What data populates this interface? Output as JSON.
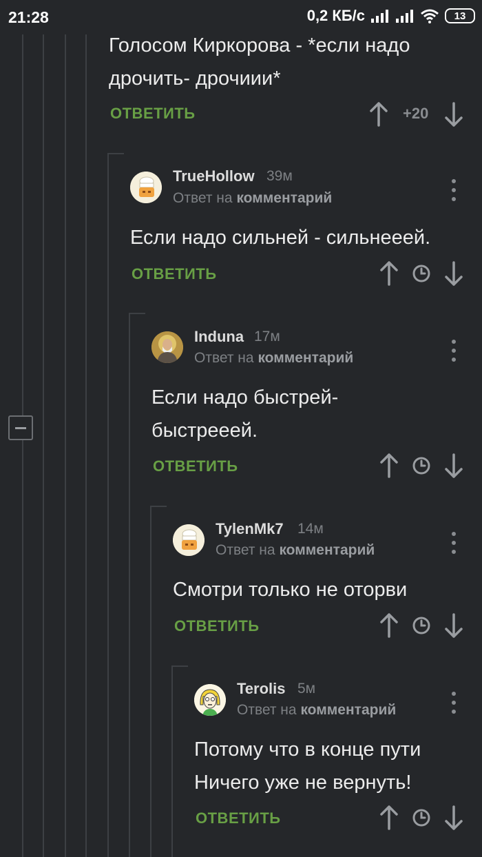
{
  "status_bar": {
    "time": "21:28",
    "net_speed": "0,2 КБ/с",
    "battery": "13",
    "icons": [
      "signal-icon",
      "signal-icon",
      "wifi-icon",
      "battery-icon"
    ]
  },
  "colors": {
    "background": "#25272a",
    "reply_green": "#689f45",
    "muted": "#7d8084"
  },
  "top_comment": {
    "text_line1": "Голосом Киркорова - *если надо",
    "text_line2": "дрочить- дрочиии*",
    "reply_label": "ОТВЕТИТЬ",
    "rating": "+20"
  },
  "comments": [
    {
      "author": "TrueHollow",
      "time": "39м",
      "reply_prefix": "Ответ на",
      "reply_target": "комментарий",
      "text_line1": "Если надо сильней - сильнееей.",
      "text_line2": "",
      "reply_label": "ОТВЕТИТЬ",
      "avatar": "chef-avatar"
    },
    {
      "author": "Induna",
      "time": "17м",
      "reply_prefix": "Ответ на",
      "reply_target": "комментарий",
      "text_line1": "Если надо быстрей-",
      "text_line2": "быстрееей.",
      "reply_label": "ОТВЕТИТЬ",
      "avatar": "icon-saint-avatar"
    },
    {
      "author": "TylenMk7",
      "time": "14м",
      "reply_prefix": "Ответ на",
      "reply_target": "комментарий",
      "text_line1": "Смотри только не оторви",
      "text_line2": "",
      "reply_label": "ОТВЕТИТЬ",
      "avatar": "chef-avatar"
    },
    {
      "author": "Terolis",
      "time": "5м",
      "reply_prefix": "Ответ на",
      "reply_target": "комментарий",
      "text_line1": "Потому что в конце пути",
      "text_line2": "Ничего уже не вернуть!",
      "reply_label": "ОТВЕТИТЬ",
      "avatar": "girl-avatar"
    }
  ]
}
